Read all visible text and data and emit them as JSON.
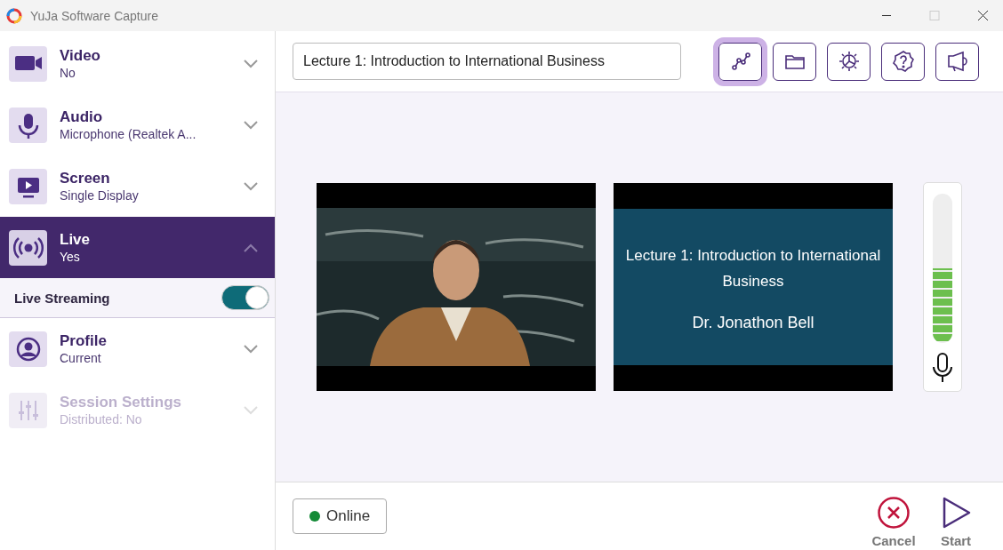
{
  "window": {
    "title": "YuJa Software Capture"
  },
  "sidebar": {
    "items": [
      {
        "kind": "video",
        "title": "Video",
        "value": "No",
        "selected": false,
        "expanded": false,
        "disabled": false
      },
      {
        "kind": "audio",
        "title": "Audio",
        "value": "Microphone (Realtek A...",
        "selected": false,
        "expanded": false,
        "disabled": false
      },
      {
        "kind": "screen",
        "title": "Screen",
        "value": "Single Display",
        "selected": false,
        "expanded": false,
        "disabled": false
      },
      {
        "kind": "live",
        "title": "Live",
        "value": "Yes",
        "selected": true,
        "expanded": true,
        "disabled": false,
        "options": [
          {
            "label": "Live Streaming",
            "on": true
          }
        ]
      },
      {
        "kind": "profile",
        "title": "Profile",
        "value": "Current",
        "selected": false,
        "expanded": false,
        "disabled": false
      },
      {
        "kind": "session",
        "title": "Session Settings",
        "value": "Distributed: No",
        "selected": false,
        "expanded": false,
        "disabled": true
      }
    ]
  },
  "toolbar": {
    "title_field": {
      "value": "Lecture 1: Introduction to International Business"
    },
    "buttons": [
      {
        "kind": "analytics",
        "selected": true
      },
      {
        "kind": "folder",
        "selected": false
      },
      {
        "kind": "settings",
        "selected": false
      },
      {
        "kind": "help",
        "selected": false
      },
      {
        "kind": "announce",
        "selected": false
      }
    ]
  },
  "preview": {
    "slide": {
      "title": "Lecture 1: Introduction to International Business",
      "author": "Dr. Jonathon Bell"
    },
    "meter": {
      "level": 0.5
    }
  },
  "footer": {
    "status": {
      "label": "Online",
      "color": "#138a36"
    },
    "actions": [
      {
        "kind": "cancel",
        "label": "Cancel"
      },
      {
        "kind": "start",
        "label": "Start"
      }
    ]
  }
}
